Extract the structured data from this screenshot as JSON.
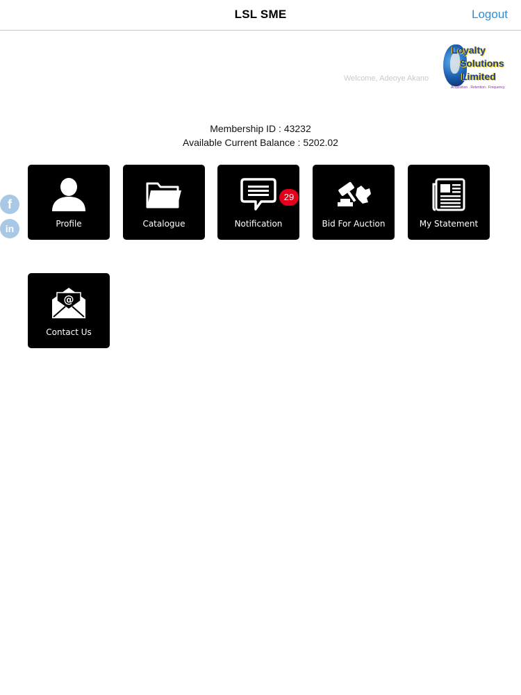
{
  "nav": {
    "title": "LSL SME",
    "logout_label": "Logout"
  },
  "header": {
    "welcome_text": "Welcome, Adeoye Akano",
    "logo": {
      "line1": "Loyalty",
      "line2": "Solutions",
      "line3": "Limited",
      "tagline": "Acquisition . Retention . Frequency"
    }
  },
  "member": {
    "membership_line": "Membership ID : 43232",
    "balance_line": "Available Current Balance : 5202.02"
  },
  "social": {
    "facebook_glyph": "f",
    "linkedin_glyph": "in"
  },
  "tiles": [
    {
      "label": "Profile",
      "icon": "user-icon"
    },
    {
      "label": "Catalogue",
      "icon": "folder-icon"
    },
    {
      "label": "Notification",
      "icon": "chat-bubble-icon",
      "badge": "29"
    },
    {
      "label": "Bid For Auction",
      "icon": "gavel-icon"
    },
    {
      "label": "My Statement",
      "icon": "newspaper-icon"
    },
    {
      "label": "Contact Us",
      "icon": "envelope-icon"
    }
  ],
  "colors": {
    "accent": "#2a8fd6",
    "tile_bg": "#000000",
    "badge_bg": "#e3001b",
    "social_bg": "#a9c8e6"
  }
}
